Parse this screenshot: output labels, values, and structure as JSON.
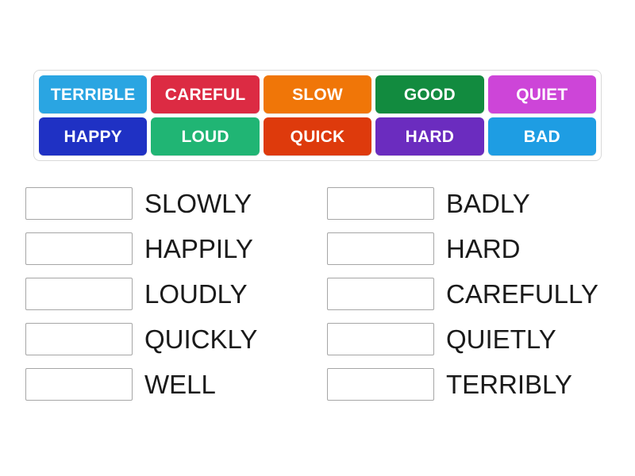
{
  "activity": {
    "type": "match-up",
    "tile_tray": {
      "tiles": [
        {
          "label": "TERRIBLE",
          "color": "#2AA5E2"
        },
        {
          "label": "CAREFUL",
          "color": "#DC2B43"
        },
        {
          "label": "SLOW",
          "color": "#F07608"
        },
        {
          "label": "GOOD",
          "color": "#128B3F"
        },
        {
          "label": "QUIET",
          "color": "#CD45D8"
        },
        {
          "label": "HAPPY",
          "color": "#1F31C4"
        },
        {
          "label": "LOUD",
          "color": "#20B574"
        },
        {
          "label": "QUICK",
          "color": "#DE3A0C"
        },
        {
          "label": "HARD",
          "color": "#6B2CBF"
        },
        {
          "label": "BAD",
          "color": "#1E9DE3"
        }
      ]
    },
    "answers": {
      "left_column": [
        {
          "dropzone_value": "",
          "label": "SLOWLY"
        },
        {
          "dropzone_value": "",
          "label": "HAPPILY"
        },
        {
          "dropzone_value": "",
          "label": "LOUDLY"
        },
        {
          "dropzone_value": "",
          "label": "QUICKLY"
        },
        {
          "dropzone_value": "",
          "label": "WELL"
        }
      ],
      "right_column": [
        {
          "dropzone_value": "",
          "label": "BADLY"
        },
        {
          "dropzone_value": "",
          "label": "HARD"
        },
        {
          "dropzone_value": "",
          "label": "CAREFULLY"
        },
        {
          "dropzone_value": "",
          "label": "QUIETLY"
        },
        {
          "dropzone_value": "",
          "label": "TERRIBLY"
        }
      ]
    }
  }
}
